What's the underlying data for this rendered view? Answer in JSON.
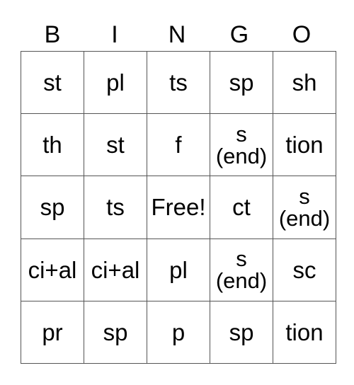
{
  "header": [
    "B",
    "I",
    "N",
    "G",
    "O"
  ],
  "rows": [
    [
      "st",
      "pl",
      "ts",
      "sp",
      "sh"
    ],
    [
      "th",
      "st",
      "f",
      "s\n(end)",
      "tion"
    ],
    [
      "sp",
      "ts",
      "Free!",
      "ct",
      "s\n(end)"
    ],
    [
      "ci+al",
      "ci+al",
      "pl",
      "s\n(end)",
      "sc"
    ],
    [
      "pr",
      "sp",
      "p",
      "sp",
      "tion"
    ]
  ]
}
